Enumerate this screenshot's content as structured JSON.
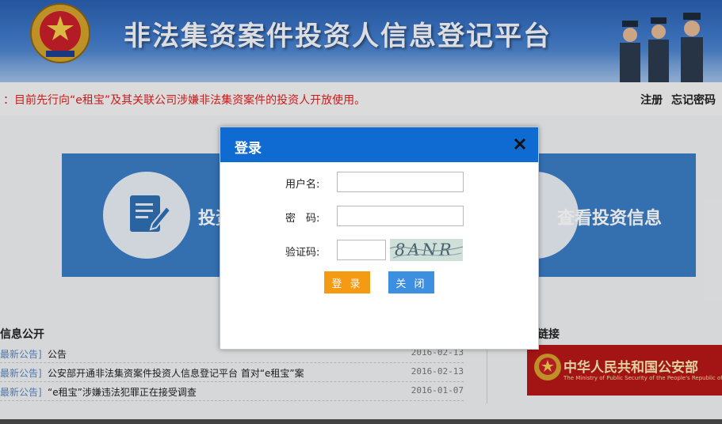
{
  "header": {
    "title": "非法集资案件投资人信息登记平台"
  },
  "notice": {
    "text": "：目前先行向“e租宝”及其关联公司涉嫌非法集资案件的投资人开放使用。"
  },
  "top_links": {
    "register": "注册",
    "forgot_password": "忘记密码"
  },
  "cards": {
    "left_label": "投资",
    "right_label": "查看投资信息"
  },
  "info_section": {
    "title": "信息公开",
    "rows": [
      {
        "tag": "最新公告]",
        "text": "公告",
        "date": "2016-02-13"
      },
      {
        "tag": "最新公告]",
        "text": "公安部开通非法集资案件投资人信息登记平台 首对“e租宝”案",
        "date": "2016-02-13"
      },
      {
        "tag": "最新公告]",
        "text": "“e租宝”涉嫌违法犯罪正在接受调查",
        "date": "2016-01-07"
      }
    ]
  },
  "links_section": {
    "title": "相关链接",
    "mps_cn": "中华人民共和国公安部",
    "mps_en": "The Ministry of Public Security of the People's Republic of China"
  },
  "modal": {
    "title": "登录",
    "username_label": "用户名:",
    "password_label": "密　码:",
    "captcha_label": "验证码:",
    "username_value": "",
    "password_value": "",
    "captcha_value": "",
    "captcha_text": "8ANR",
    "login_button": "登 录",
    "close_button": "关 闭"
  },
  "colors": {
    "modal_header": "#0f6bd1",
    "login_button": "#f59a13",
    "close_button": "#3d8fe0",
    "notice_text": "#e02020",
    "card_blue": "#3a7cc4"
  }
}
